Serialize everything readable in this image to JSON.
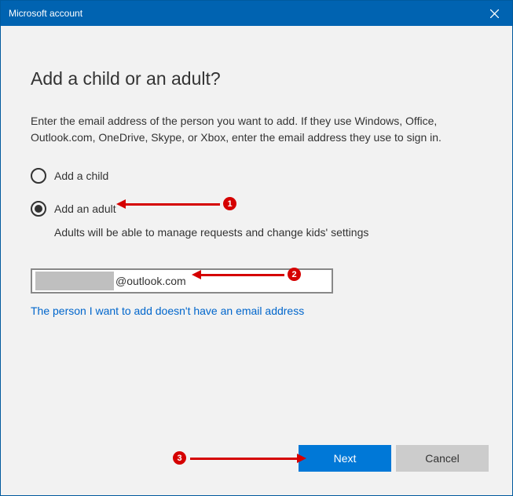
{
  "titlebar": {
    "title": "Microsoft account"
  },
  "main": {
    "heading": "Add a child or an adult?",
    "description": "Enter the email address of the person you want to add. If they use Windows, Office, Outlook.com, OneDrive, Skype, or Xbox, enter the email address they use to sign in.",
    "radio_child_label": "Add a child",
    "radio_adult_label": "Add an adult",
    "adult_hint": "Adults will be able to manage requests and change kids' settings",
    "email_value": "@outlook.com",
    "no_email_link": "The person I want to add doesn't have an email address"
  },
  "footer": {
    "next_label": "Next",
    "cancel_label": "Cancel"
  },
  "annotations": {
    "n1": "1",
    "n2": "2",
    "n3": "3"
  }
}
